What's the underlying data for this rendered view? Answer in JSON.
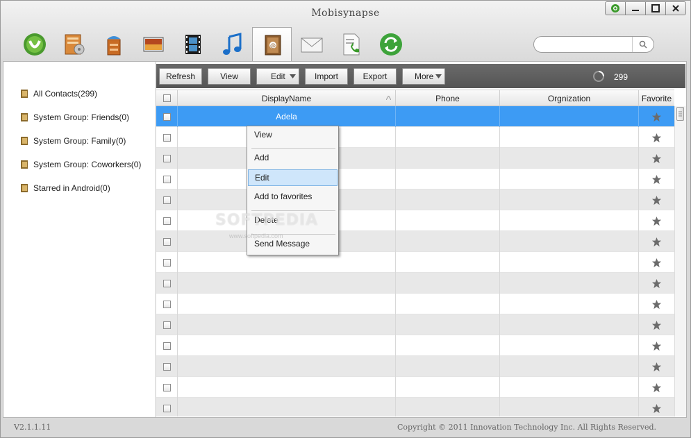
{
  "window": {
    "title": "Mobisynapse"
  },
  "toolbar": {
    "tools": [
      {
        "name": "home-icon"
      },
      {
        "name": "applications-icon"
      },
      {
        "name": "files-icon"
      },
      {
        "name": "photos-icon"
      },
      {
        "name": "videos-icon"
      },
      {
        "name": "music-icon"
      },
      {
        "name": "contacts-icon",
        "active": true
      },
      {
        "name": "messages-icon"
      },
      {
        "name": "call-log-icon"
      },
      {
        "name": "sync-icon"
      }
    ]
  },
  "search": {
    "value": "",
    "placeholder": ""
  },
  "sidebar": {
    "items": [
      {
        "label": "All Contacts(299)"
      },
      {
        "label": "System Group: Friends(0)"
      },
      {
        "label": "System Group: Family(0)"
      },
      {
        "label": "System Group: Coworkers(0)"
      },
      {
        "label": "Starred in Android(0)"
      }
    ]
  },
  "actions": {
    "refresh": "Refresh",
    "view": "View",
    "edit": "Edit",
    "import": "Import",
    "export": "Export",
    "more": "More",
    "count": "299"
  },
  "table": {
    "columns": {
      "display_name": "DisplayName",
      "phone": "Phone",
      "organization": "Orgnization",
      "favorite": "Favorite"
    },
    "rows": [
      {
        "name": "Adela",
        "phone": "",
        "org": "",
        "selected": true
      },
      {
        "name": "",
        "phone": "",
        "org": ""
      },
      {
        "name": "",
        "phone": "",
        "org": ""
      },
      {
        "name": "",
        "phone": "",
        "org": ""
      },
      {
        "name": "",
        "phone": "",
        "org": ""
      },
      {
        "name": "",
        "phone": "",
        "org": ""
      },
      {
        "name": "",
        "phone": "",
        "org": ""
      },
      {
        "name": "",
        "phone": "",
        "org": ""
      },
      {
        "name": "",
        "phone": "",
        "org": ""
      },
      {
        "name": "",
        "phone": "",
        "org": ""
      },
      {
        "name": "",
        "phone": "",
        "org": ""
      },
      {
        "name": "",
        "phone": "",
        "org": ""
      },
      {
        "name": "",
        "phone": "",
        "org": ""
      },
      {
        "name": "",
        "phone": "",
        "org": ""
      },
      {
        "name": "",
        "phone": "",
        "org": ""
      },
      {
        "name": "",
        "phone": "",
        "org": ""
      }
    ]
  },
  "context_menu": {
    "view": "View",
    "add": "Add",
    "edit": "Edit",
    "add_to_favorites": "Add to favorites",
    "delete": "Delete",
    "send_message": "Send Message"
  },
  "watermark": {
    "text": "SOFTPEDIA",
    "sub": "www.softpedia.com"
  },
  "status": {
    "version": "V2.1.1.11",
    "copyright": "Copyright © 2011 Innovation Technology Inc. All Rights Reserved."
  },
  "colors": {
    "selection": "#3d9bf4",
    "action_bar": "#5e5e5e",
    "star": "#6b6b6b"
  }
}
